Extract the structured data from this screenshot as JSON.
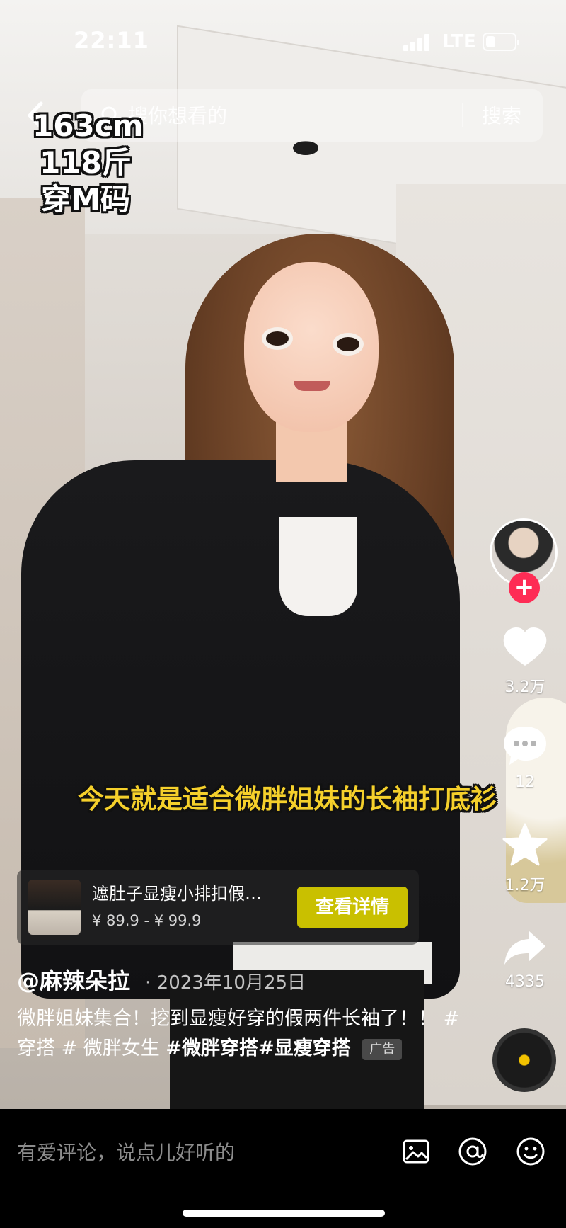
{
  "status_bar": {
    "time": "22:11",
    "network": "LTE",
    "battery_level": 0.35
  },
  "search": {
    "placeholder": "搜你想看的",
    "button_label": "搜索"
  },
  "video": {
    "caption_top_left": [
      "163cm",
      "118斤",
      "穿M码"
    ],
    "subtitle": "今天就是适合微胖姐妹的长袖打底衫"
  },
  "actions": {
    "likes": "3.2万",
    "comments": "12",
    "favorites": "1.2万",
    "shares": "4335",
    "follow_label": "+"
  },
  "product": {
    "title": "遮肚子显瘦小排扣假…",
    "price": "¥ 89.9 - ¥ 99.9",
    "cta_label": "查看详情"
  },
  "post": {
    "author": "@麻辣朵拉",
    "date": "· 2023年10月25日",
    "description_text": "微胖姐妹集合！挖到显瘦好穿的假两件长袖了！！",
    "tags_plain": "# 穿搭 # 微胖女生",
    "tags_bold": "#微胖穿搭#显瘦穿搭",
    "ad_label": "广告"
  },
  "comment_bar": {
    "placeholder": "有爱评论，说点儿好听的"
  },
  "icons": {
    "back": "chevron-left-icon",
    "search": "search-icon",
    "like": "heart-icon",
    "comment": "comment-bubble-icon",
    "favorite": "star-icon",
    "share": "share-arrow-icon",
    "image": "image-icon",
    "mention": "at-icon",
    "emoji": "emoji-icon"
  },
  "colors": {
    "accent": "#fe2c55",
    "cta": "#c9c000",
    "subtitle": "#f5d02b"
  }
}
